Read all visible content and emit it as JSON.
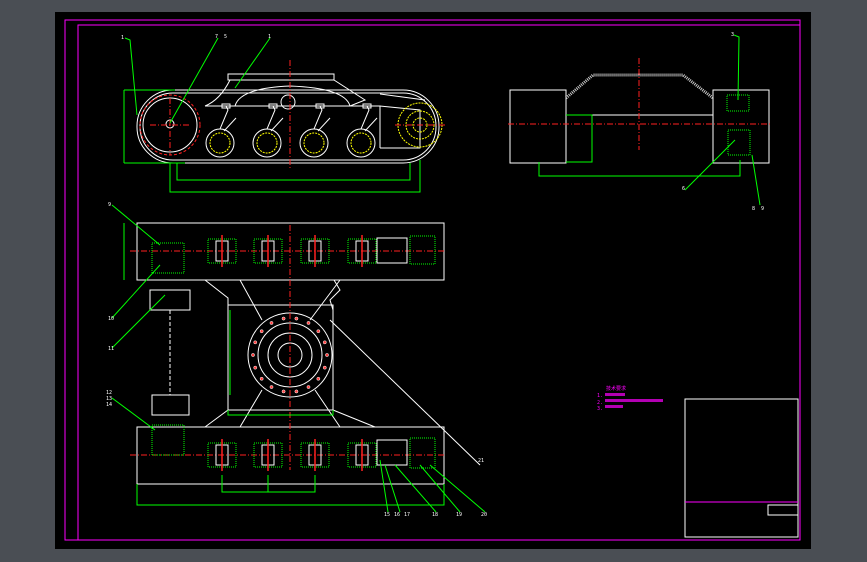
{
  "drawing": {
    "colors": {
      "background": "#000000",
      "frame": "#ff00ff",
      "outline": "#ffffff",
      "dimension": "#00ff00",
      "centerline": "#ff2020",
      "hidden": "#ffff00",
      "window_gray": "#4a4e54"
    },
    "side_view": {
      "balloons": [
        "1",
        "7",
        "5",
        "1"
      ]
    },
    "end_view": {
      "balloons": [
        "3",
        "6",
        "8",
        "9"
      ]
    },
    "plan_view": {
      "balloons": [
        "9",
        "10",
        "11",
        "12",
        "13",
        "14",
        "15",
        "16",
        "17",
        "18",
        "19",
        "20",
        "21"
      ]
    },
    "notes": {
      "heading": "技术要求",
      "lines": [
        "1.",
        "2.",
        "3."
      ]
    }
  }
}
